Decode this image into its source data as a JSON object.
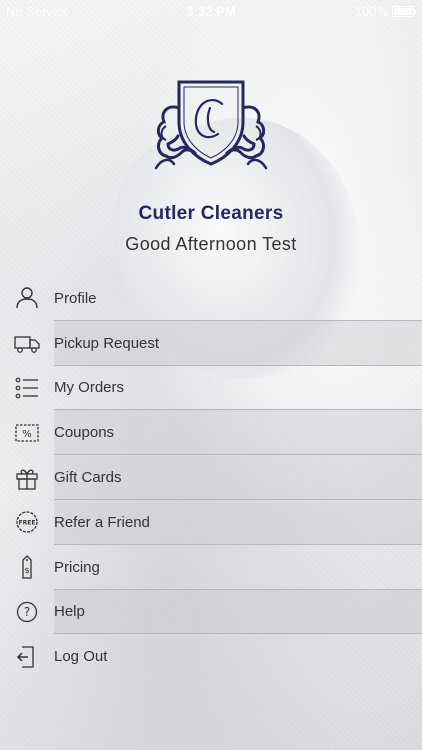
{
  "status_bar": {
    "carrier": "No Service",
    "time": "3:32 PM",
    "battery": "100%"
  },
  "brand": {
    "name": "Cutler Cleaners",
    "logo_letter": "C",
    "color": "#25275d"
  },
  "greeting": "Good Afternoon Test",
  "menu": {
    "items": [
      {
        "label": "Profile",
        "icon": "person-icon"
      },
      {
        "label": "Pickup Request",
        "icon": "truck-icon"
      },
      {
        "label": "My Orders",
        "icon": "list-icon"
      },
      {
        "label": "Coupons",
        "icon": "coupon-icon"
      },
      {
        "label": "Gift Cards",
        "icon": "gift-icon"
      },
      {
        "label": "Refer a Friend",
        "icon": "free-badge-icon",
        "icon_text": "FREE"
      },
      {
        "label": "Pricing",
        "icon": "price-tag-icon"
      },
      {
        "label": "Help",
        "icon": "help-icon"
      },
      {
        "label": "Log Out",
        "icon": "logout-icon"
      }
    ]
  }
}
